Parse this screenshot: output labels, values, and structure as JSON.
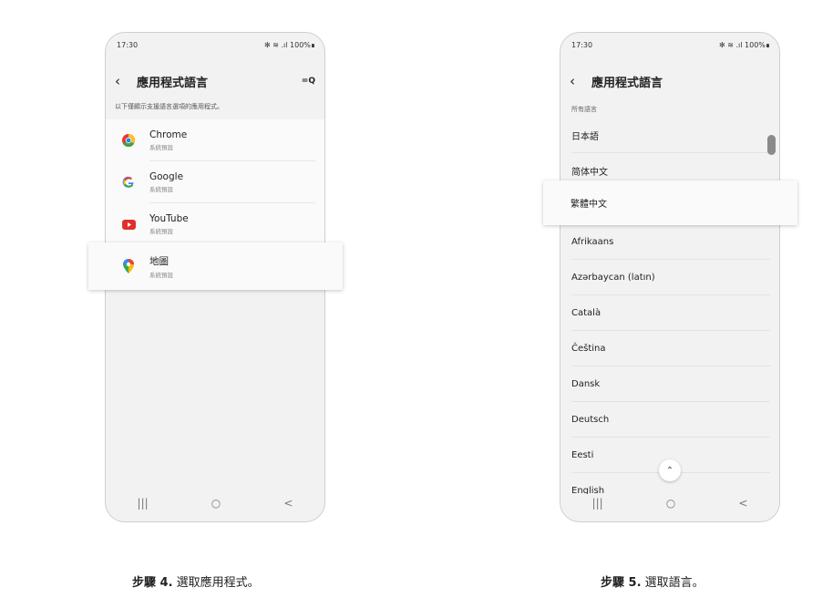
{
  "screen1": {
    "status": {
      "time": "17:30",
      "icons": "✻ ≋ .ıl 100%∎"
    },
    "title": "應用程式語言",
    "search_glyph": "=Q",
    "subtitle": "以下僅顯示支援語言選項的應用程式。",
    "apps": [
      {
        "name": "Chrome",
        "sub": "系統預設",
        "icon": "chrome-icon"
      },
      {
        "name": "Google",
        "sub": "系統預設",
        "icon": "google-icon"
      },
      {
        "name": "YouTube",
        "sub": "系統預設",
        "icon": "youtube-icon"
      },
      {
        "name": "地圖",
        "sub": "系統預設",
        "icon": "maps-icon"
      }
    ],
    "nav": {
      "recent": "|||",
      "home": "○",
      "back": "<"
    }
  },
  "screen2": {
    "status": {
      "time": "17:30",
      "icons": "✻ ≋ .ıl 100%∎"
    },
    "title": "應用程式語言",
    "section": "所有語言",
    "languages": [
      "日本語",
      "简体中文",
      "繁體中文",
      "Afrikaans",
      "Azərbaycan (latın)",
      "Català",
      "Čeština",
      "Dansk",
      "Deutsch",
      "Eesti",
      "English"
    ],
    "fab": "⌃",
    "nav": {
      "recent": "|||",
      "home": "○",
      "back": "<"
    }
  },
  "captions": [
    {
      "step": "步驟 4.",
      "text": "選取應用程式。"
    },
    {
      "step": "步驟 5.",
      "text": "選取語言。"
    }
  ]
}
